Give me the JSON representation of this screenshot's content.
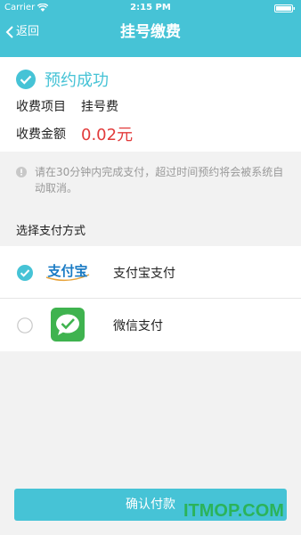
{
  "status_bar": {
    "carrier": "Carrier",
    "time": "2:15 PM"
  },
  "nav": {
    "back_label": "返回",
    "title": "挂号缴费"
  },
  "booking": {
    "success_text": "预约成功",
    "item_key": "收费项目",
    "item_value": "挂号费",
    "amount_key": "收费金额",
    "amount_value": "0.02元"
  },
  "notice": {
    "text": "请在30分钟内完成支付，超过时间预约将会被系统自动取消。"
  },
  "payment": {
    "section_title": "选择支付方式",
    "methods": [
      {
        "label": "支付宝支付",
        "logo_text": "支付宝",
        "selected": true,
        "icon": "alipay-icon"
      },
      {
        "label": "微信支付",
        "selected": false,
        "icon": "wechat-pay-icon"
      }
    ]
  },
  "confirm_label": "确认付款",
  "watermark": "ITMOP.COM",
  "colors": {
    "accent": "#46c3d6",
    "amount": "#e23b3b",
    "wechat": "#3fb34f",
    "alipay": "#1a7bc4"
  }
}
